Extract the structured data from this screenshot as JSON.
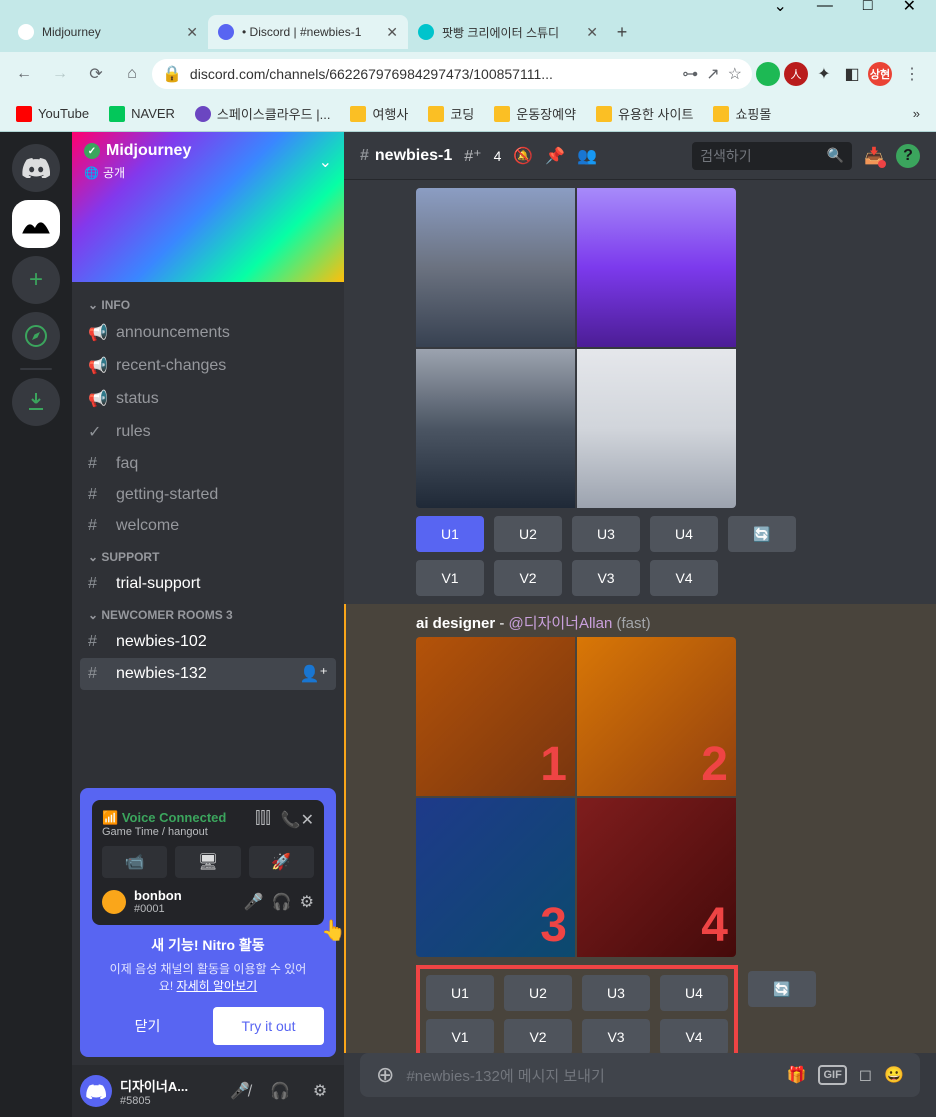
{
  "window": {
    "tabs": [
      {
        "title": "Midjourney",
        "active": false
      },
      {
        "title": "• Discord | #newbies-1",
        "active": true
      },
      {
        "title": "팟빵 크리에이터 스튜디",
        "active": false
      }
    ]
  },
  "urlbar": {
    "url": "discord.com/channels/662267976984297473/100857111..."
  },
  "bookmarks": [
    {
      "label": "YouTube",
      "color": "#ff0000"
    },
    {
      "label": "NAVER",
      "color": "#03c75a"
    },
    {
      "label": "스페이스클라우드 |...",
      "color": "#6b46c1"
    },
    {
      "label": "여행사",
      "color": "#fbbf24"
    },
    {
      "label": "코딩",
      "color": "#fbbf24"
    },
    {
      "label": "운동장예약",
      "color": "#fbbf24"
    },
    {
      "label": "유용한 사이트",
      "color": "#fbbf24"
    },
    {
      "label": "쇼핑몰",
      "color": "#fbbf24"
    }
  ],
  "server": {
    "name": "Midjourney",
    "public": "공개"
  },
  "channels": {
    "info_category": "INFO",
    "info": [
      "announcements",
      "recent-changes",
      "status",
      "rules",
      "faq",
      "getting-started",
      "welcome"
    ],
    "support_category": "SUPPORT",
    "support": [
      "trial-support"
    ],
    "newcomer_category": "NEWCOMER ROOMS 3",
    "newcomer": [
      "newbies-102",
      "newbies-132"
    ]
  },
  "voice": {
    "status": "Voice Connected",
    "sub": "Game Time / hangout",
    "user": "bonbon",
    "tag": "#0001"
  },
  "nitro": {
    "title": "새 기능! Nitro 활동",
    "desc1": "이제 음성 채널의 활동을 이용할 수 있어",
    "desc2": "요! ",
    "link": "자세히 알아보기",
    "close": "닫기",
    "try": "Try it out"
  },
  "user": {
    "name": "디자이너A...",
    "tag": "#5805"
  },
  "header": {
    "channel": "newbies-1",
    "threads": "4",
    "search": "검색하기"
  },
  "msg1": {
    "buttons_u": [
      "U1",
      "U2",
      "U3",
      "U4"
    ],
    "buttons_v": [
      "V1",
      "V2",
      "V3",
      "V4"
    ]
  },
  "msg2": {
    "author": "ai designer",
    "sep": " - ",
    "mention": "@디자이너Allan",
    "mode": " (fast)",
    "numbers": [
      "1",
      "2",
      "3",
      "4"
    ],
    "buttons_u": [
      "U1",
      "U2",
      "U3",
      "U4"
    ],
    "buttons_v": [
      "V1",
      "V2",
      "V3",
      "V4"
    ]
  },
  "input": {
    "placeholder": "#newbies-132에 메시지 보내기"
  },
  "ext_badge": "상현"
}
